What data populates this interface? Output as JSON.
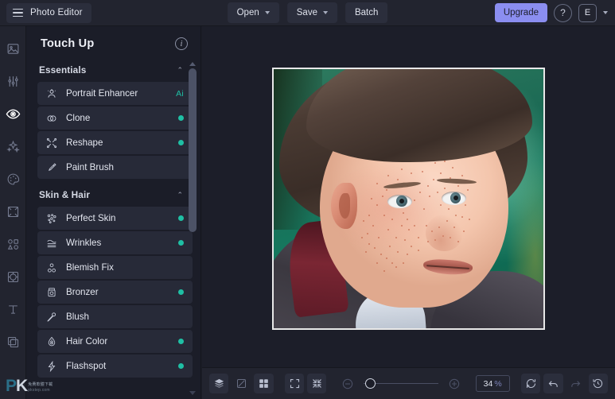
{
  "app": {
    "brand_label": "Photo Editor",
    "menu_icon": "hamburger-icon"
  },
  "topbar": {
    "open_label": "Open",
    "save_label": "Save",
    "batch_label": "Batch",
    "upgrade_label": "Upgrade",
    "help_label": "?",
    "avatar_label": "E",
    "accent_upgrade": "#8b8ef0"
  },
  "rail": {
    "items": [
      {
        "name": "image-icon",
        "active": false
      },
      {
        "name": "adjust-sliders-icon",
        "active": false
      },
      {
        "name": "eye-retouch-icon",
        "active": true
      },
      {
        "name": "sparkles-effects-icon",
        "active": false
      },
      {
        "name": "palette-color-icon",
        "active": false
      },
      {
        "name": "crop-frame-icon",
        "active": false
      },
      {
        "name": "shapes-icon",
        "active": false
      },
      {
        "name": "sticker-frame-icon",
        "active": false
      },
      {
        "name": "text-icon",
        "active": false
      },
      {
        "name": "layers-overlay-icon",
        "active": false
      }
    ]
  },
  "panel": {
    "title": "Touch Up",
    "info_icon": "i",
    "sections": [
      {
        "title": "Essentials",
        "collapse_chevron": "⌃",
        "tools": [
          {
            "label": "Portrait Enhancer",
            "icon": "portrait-enhancer-icon",
            "badge": "Ai",
            "dot": false
          },
          {
            "label": "Clone",
            "icon": "clone-icon",
            "badge": "",
            "dot": true
          },
          {
            "label": "Reshape",
            "icon": "reshape-icon",
            "badge": "",
            "dot": true
          },
          {
            "label": "Paint Brush",
            "icon": "paint-brush-icon",
            "badge": "",
            "dot": false
          }
        ]
      },
      {
        "title": "Skin & Hair",
        "collapse_chevron": "⌃",
        "tools": [
          {
            "label": "Perfect Skin",
            "icon": "perfect-skin-icon",
            "badge": "",
            "dot": true
          },
          {
            "label": "Wrinkles",
            "icon": "wrinkles-icon",
            "badge": "",
            "dot": true
          },
          {
            "label": "Blemish Fix",
            "icon": "blemish-fix-icon",
            "badge": "",
            "dot": false
          },
          {
            "label": "Bronzer",
            "icon": "bronzer-icon",
            "badge": "",
            "dot": true
          },
          {
            "label": "Blush",
            "icon": "blush-icon",
            "badge": "",
            "dot": false
          },
          {
            "label": "Hair Color",
            "icon": "hair-color-icon",
            "badge": "",
            "dot": true
          },
          {
            "label": "Flashspot",
            "icon": "flashspot-icon",
            "badge": "",
            "dot": true
          }
        ]
      }
    ],
    "dot_color": "#1fbfa4"
  },
  "bottombar": {
    "zoom_value": "34",
    "zoom_unit": "%",
    "buttons": [
      {
        "name": "layers-button",
        "icon": "layers-icon"
      },
      {
        "name": "compare-button",
        "icon": "compare-icon"
      },
      {
        "name": "grid-view-button",
        "icon": "grid-icon"
      },
      {
        "name": "fit-screen-button",
        "icon": "fit-frame-icon"
      },
      {
        "name": "actual-size-button",
        "icon": "collapse-arrows-icon"
      },
      {
        "name": "zoom-out-button",
        "icon": "minus-circle-icon"
      },
      {
        "name": "zoom-in-button",
        "icon": "plus-circle-icon"
      },
      {
        "name": "reset-button",
        "icon": "refresh-icon"
      },
      {
        "name": "undo-button",
        "icon": "undo-arrow-icon"
      },
      {
        "name": "redo-button",
        "icon": "redo-arrow-icon"
      },
      {
        "name": "history-button",
        "icon": "history-clock-icon"
      }
    ]
  },
  "watermark": {
    "logo": "PK",
    "line1": "免費軟體下載",
    "line2": "pkstep.com"
  },
  "canvas": {
    "photo_alt": "portrait-photo-boy-freckles"
  }
}
